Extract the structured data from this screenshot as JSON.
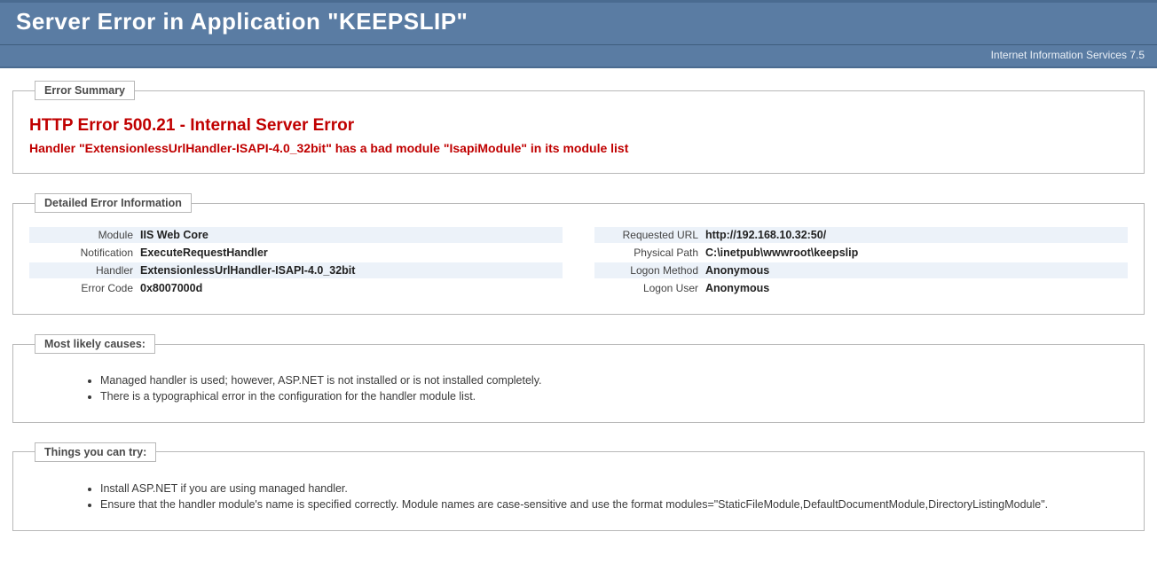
{
  "header": {
    "title": "Server Error in Application \"KEEPSLIP\"",
    "product": "Internet Information Services 7.5"
  },
  "summary": {
    "legend": "Error Summary",
    "title": "HTTP Error 500.21 - Internal Server Error",
    "message": "Handler \"ExtensionlessUrlHandler-ISAPI-4.0_32bit\" has a bad module \"IsapiModule\" in its module list"
  },
  "details": {
    "legend": "Detailed Error Information",
    "left": [
      {
        "label": "Module",
        "value": "IIS Web Core"
      },
      {
        "label": "Notification",
        "value": "ExecuteRequestHandler"
      },
      {
        "label": "Handler",
        "value": "ExtensionlessUrlHandler-ISAPI-4.0_32bit"
      },
      {
        "label": "Error Code",
        "value": "0x8007000d"
      }
    ],
    "right": [
      {
        "label": "Requested URL",
        "value": "http://192.168.10.32:50/"
      },
      {
        "label": "Physical Path",
        "value": "C:\\inetpub\\wwwroot\\keepslip"
      },
      {
        "label": "Logon Method",
        "value": "Anonymous"
      },
      {
        "label": "Logon User",
        "value": "Anonymous"
      }
    ]
  },
  "causes": {
    "legend": "Most likely causes:",
    "items": [
      "Managed handler is used; however, ASP.NET is not installed or is not installed completely.",
      "There is a typographical error in the configuration for the handler module list."
    ]
  },
  "tries": {
    "legend": "Things you can try:",
    "items": [
      "Install ASP.NET if you are using managed handler.",
      "Ensure that the handler module's name is specified correctly. Module names are case-sensitive and use the format modules=\"StaticFileModule,DefaultDocumentModule,DirectoryListingModule\"."
    ]
  }
}
